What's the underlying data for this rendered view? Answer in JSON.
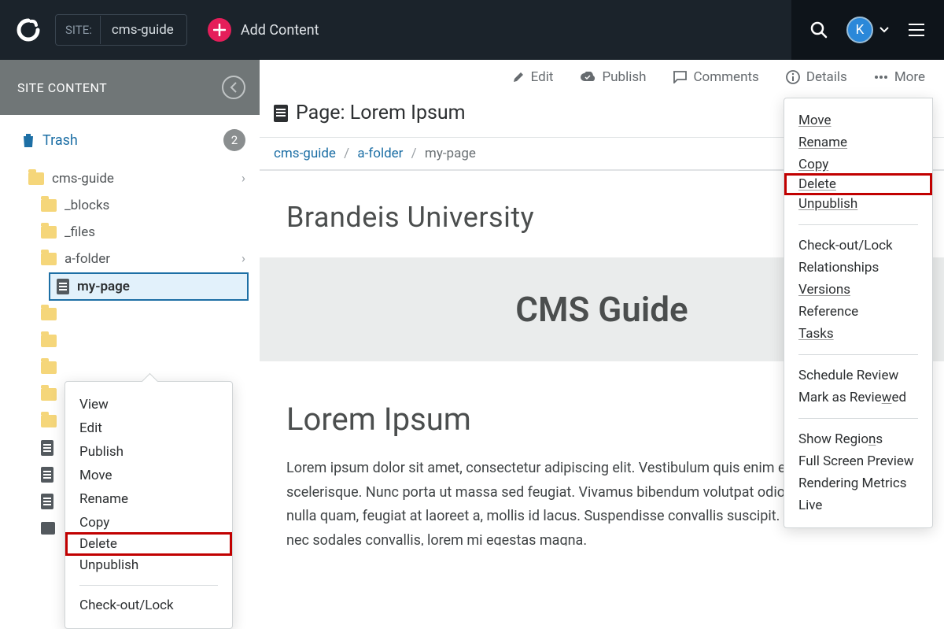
{
  "topbar": {
    "site_label": "SITE:",
    "site_value": "cms-guide",
    "add_content": "Add Content",
    "avatar_initial": "K"
  },
  "sidebar": {
    "header": "SITE CONTENT",
    "trash_label": "Trash",
    "trash_count": "2",
    "tree": {
      "root": "cms-guide",
      "blocks": "_blocks",
      "files": "_files",
      "afolder": "a-folder",
      "mypage": "my-page"
    }
  },
  "context_menu": {
    "view": "View",
    "edit": "Edit",
    "publish": "Publish",
    "move": "Move",
    "rename": "Rename",
    "copy": "Copy",
    "delete": "Delete",
    "unpublish": "Unpublish",
    "checkout": "Check-out/Lock"
  },
  "actionbar": {
    "edit": "Edit",
    "publish": "Publish",
    "comments": "Comments",
    "details": "Details",
    "more": "More"
  },
  "page": {
    "title_prefix": "Page: ",
    "title": "Lorem Ipsum",
    "crumb1": "cms-guide",
    "crumb2": "a-folder",
    "crumb3": "my-page",
    "university": "Brandeis University",
    "banner": "CMS Guide",
    "heading": "Lorem Ipsum",
    "body": "Lorem ipsum dolor sit amet, consectetur adipiscing elit. Vestibulum quis enim eu leo pulvinar scelerisque. Nunc porta ut massa sed feugiat. Vivamus bibendum volutpat odio vel pharetra. Fusce nulla quam, feugiat at laoreet a, mollis id lacus. Suspendisse convallis suscipit. Etiam aliquet, turpis nec sodales convallis, lorem mi egestas magna."
  },
  "more_menu": {
    "move": "Move",
    "rename": "Rename",
    "copy": "Copy",
    "delete": "Delete",
    "unpublish": "Unpublish",
    "checkout": "Check-out/Lock",
    "relationships": "Relationships",
    "versions": "Versions",
    "reference": "Reference",
    "tasks": "Tasks",
    "schedule": "Schedule Review",
    "reviewed": "Mark as Reviewed",
    "regions": "Show Regions",
    "fullscreen": "Full Screen Preview",
    "metrics": "Rendering Metrics",
    "live": "Live"
  }
}
